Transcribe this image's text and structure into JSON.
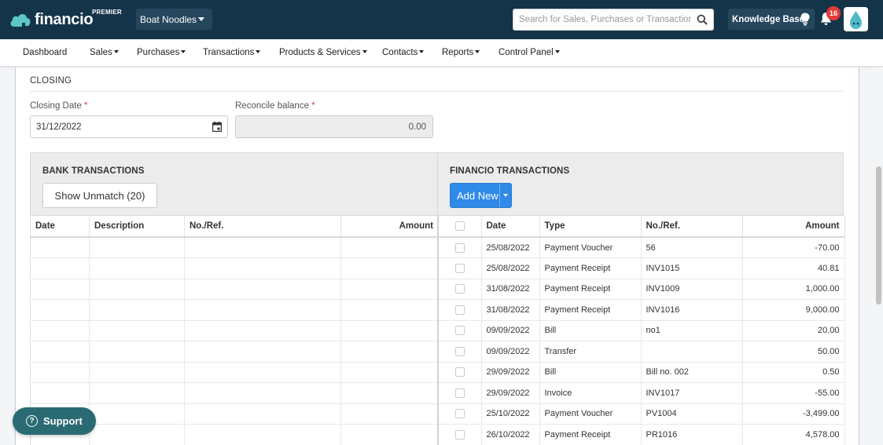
{
  "header": {
    "brand": "financio",
    "tier": "PREMIER",
    "company": "Boat Noodles",
    "search_placeholder": "Search for Sales, Purchases or Transactions",
    "knowledge_base": "Knowledge Base",
    "notification_count": "16"
  },
  "nav": {
    "dashboard": "Dashboard",
    "sales": "Sales",
    "purchases": "Purchases",
    "transactions": "Transactions",
    "products": "Products & Services",
    "contacts": "Contacts",
    "reports": "Reports",
    "control_panel": "Control Panel"
  },
  "closing": {
    "title": "CLOSING",
    "date_label": "Closing Date",
    "date_value": "31/12/2022",
    "balance_label": "Reconcile balance",
    "balance_value": "0.00",
    "required_mark": "*"
  },
  "bank": {
    "title": "BANK TRANSACTIONS",
    "button": "Show Unmatch (20)",
    "columns": [
      "Date",
      "Description",
      "No./Ref.",
      "Amount"
    ]
  },
  "financio": {
    "title": "FINANCIO TRANSACTIONS",
    "button": "Add New",
    "columns": [
      "Date",
      "Type",
      "No./Ref.",
      "Amount"
    ],
    "rows": [
      {
        "date": "25/08/2022",
        "type": "Payment Voucher",
        "ref": "56",
        "amount": "-70.00"
      },
      {
        "date": "25/08/2022",
        "type": "Payment Receipt",
        "ref": "INV1015",
        "amount": "40.81"
      },
      {
        "date": "31/08/2022",
        "type": "Payment Receipt",
        "ref": "INV1009",
        "amount": "1,000.00"
      },
      {
        "date": "31/08/2022",
        "type": "Payment Receipt",
        "ref": "INV1016",
        "amount": "9,000.00"
      },
      {
        "date": "09/09/2022",
        "type": "Bill",
        "ref": "no1",
        "amount": "20.00"
      },
      {
        "date": "09/09/2022",
        "type": "Transfer",
        "ref": "",
        "amount": "50.00"
      },
      {
        "date": "29/09/2022",
        "type": "Bill",
        "ref": "Bill no. 002",
        "amount": "0.50"
      },
      {
        "date": "29/09/2022",
        "type": "Invoice",
        "ref": "INV1017",
        "amount": "-55.00"
      },
      {
        "date": "25/10/2022",
        "type": "Payment Voucher",
        "ref": "PV1004",
        "amount": "-3,499.00"
      },
      {
        "date": "26/10/2022",
        "type": "Payment Receipt",
        "ref": "PR1016",
        "amount": "4,578.00"
      }
    ]
  },
  "support": {
    "label": "Support"
  },
  "colors": {
    "topbar": "#14344a",
    "accent": "#2f8ae8",
    "support": "#2a6b73",
    "badge": "#e53935"
  }
}
